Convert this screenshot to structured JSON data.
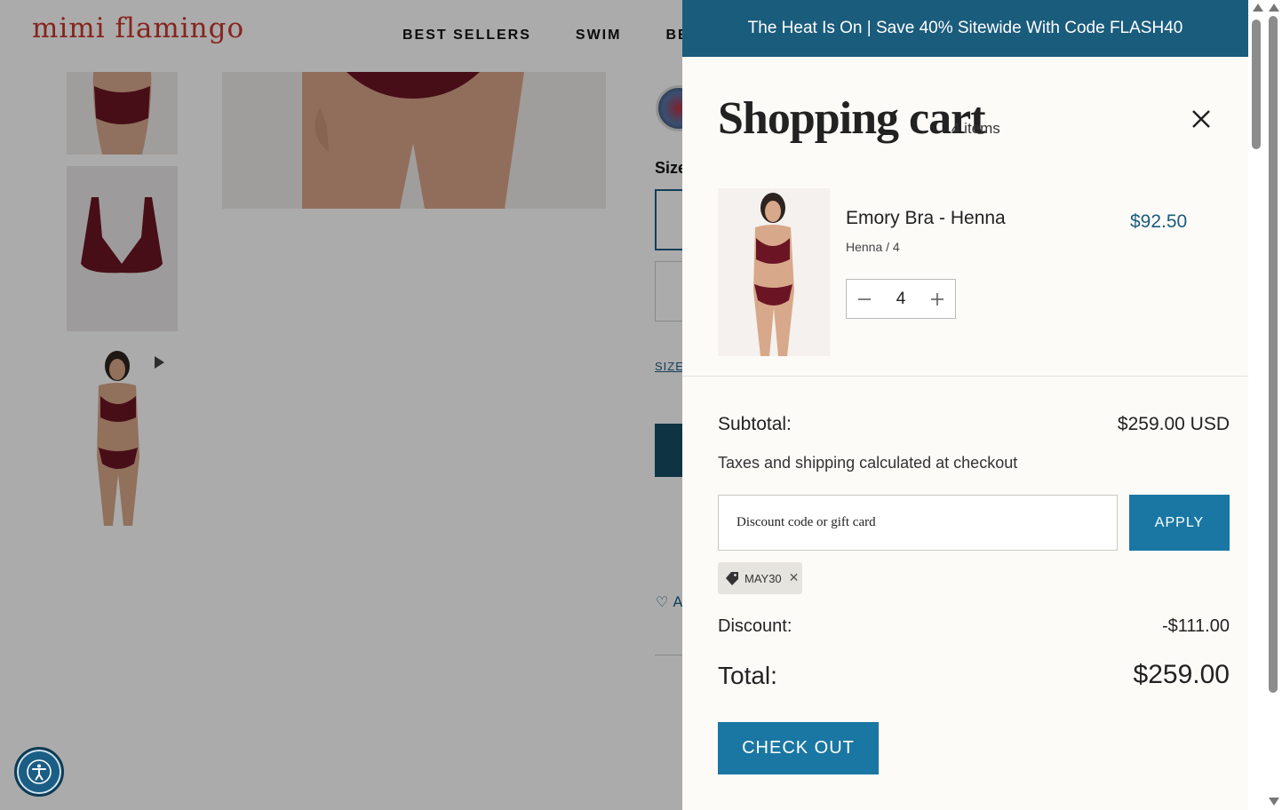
{
  "site": {
    "logo": "mimi flamingo",
    "nav": [
      "BEST SELLERS",
      "SWIM",
      "BEACH"
    ]
  },
  "product_page": {
    "size_label": "Size",
    "size_guide": "SIZE",
    "wishlist_label": "A"
  },
  "cart": {
    "promo": "The Heat Is On | Save 40% Sitewide With Code FLASH40",
    "title": "Shopping cart",
    "count": "4 items",
    "items": [
      {
        "name": "Emory Bra - Henna",
        "variant": "Henna / 4",
        "price": "$92.50",
        "quantity": "4"
      }
    ],
    "subtotal_label": "Subtotal:",
    "subtotal_value": "$259.00 USD",
    "tax_note": "Taxes and shipping calculated at checkout",
    "discount_placeholder": "Discount code or gift card",
    "apply_label": "APPLY",
    "applied_code": "MAY30",
    "discount_label": "Discount:",
    "discount_value": "-$111.00",
    "total_label": "Total:",
    "total_value": "$259.00",
    "checkout_label": "CHECK OUT"
  },
  "colors": {
    "brand_red": "#c8372d",
    "promo_bg": "#1a5c7c",
    "button_blue": "#1a77a3",
    "drawer_bg": "#fcfbf8"
  },
  "icons": [
    "play-icon",
    "accessibility-icon",
    "close-icon",
    "minus-icon",
    "plus-icon",
    "tag-icon",
    "remove-code-icon",
    "heart-icon"
  ]
}
